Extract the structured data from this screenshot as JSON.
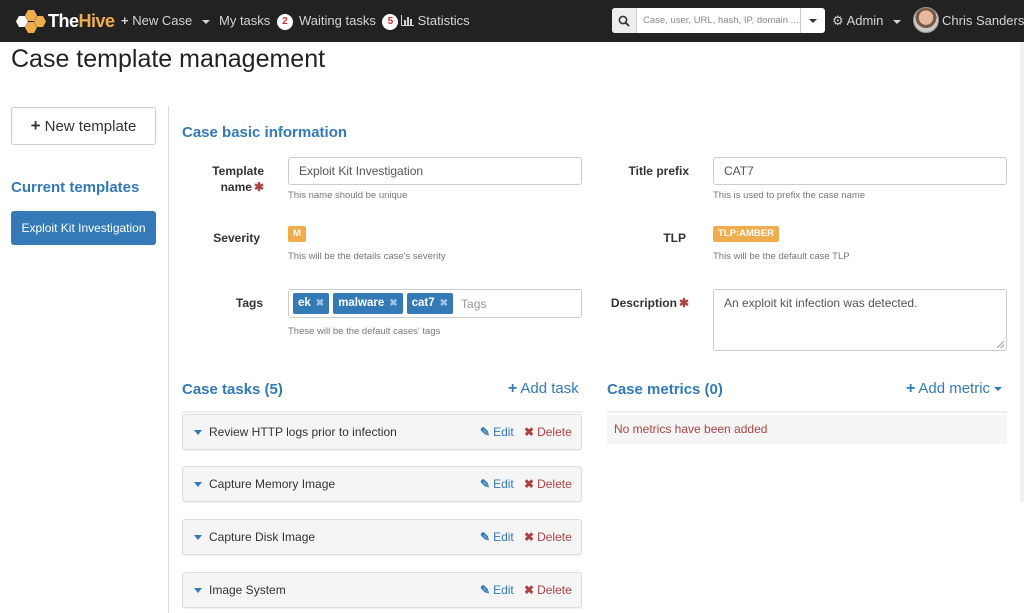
{
  "navbar": {
    "brand_part1": "The",
    "brand_part2": "Hive",
    "new_case": "New Case",
    "my_tasks": "My tasks",
    "my_tasks_count": "2",
    "waiting_tasks": "Waiting tasks",
    "waiting_tasks_count": "5",
    "statistics": "Statistics",
    "search_placeholder": "Case, user, URL, hash, IP, domain ...",
    "admin": "Admin",
    "user_name": "Chris Sanders"
  },
  "page": {
    "title": "Case template management"
  },
  "sidebar": {
    "new_template": "New template",
    "heading": "Current templates",
    "templates": [
      "Exploit Kit Investigation"
    ]
  },
  "form": {
    "section_title": "Case basic information",
    "template_name_label_line1": "Template",
    "template_name_label_line2": "name",
    "template_name_value": "Exploit Kit Investigation",
    "template_name_help": "This name should be unique",
    "title_prefix_label": "Title prefix",
    "title_prefix_value": "CAT7",
    "title_prefix_help": "This is used to prefix the case name",
    "severity_label": "Severity",
    "severity_value": "M",
    "severity_help": "This will be the details case's severity",
    "tlp_label": "TLP",
    "tlp_value": "TLP:AMBER",
    "tlp_help": "This will be the default case TLP",
    "tags_label": "Tags",
    "tags": [
      "ek",
      "malware",
      "cat7"
    ],
    "tags_placeholder": "Tags",
    "tags_help": "These will be the default cases' tags",
    "description_label": "Description",
    "description_value": "An exploit kit infection was detected."
  },
  "tasks": {
    "title": "Case tasks (5)",
    "add_label": "Add task",
    "edit_label": "Edit",
    "delete_label": "Delete",
    "items": [
      "Review HTTP logs prior to infection",
      "Capture Memory Image",
      "Capture Disk Image",
      "Image System"
    ]
  },
  "metrics": {
    "title": "Case metrics (0)",
    "add_label": "Add metric",
    "empty_message": "No metrics have been added"
  },
  "colors": {
    "navbar_bg": "#222222",
    "primary": "#337ab7",
    "warning": "#f0ad4e",
    "danger": "#a94442"
  }
}
